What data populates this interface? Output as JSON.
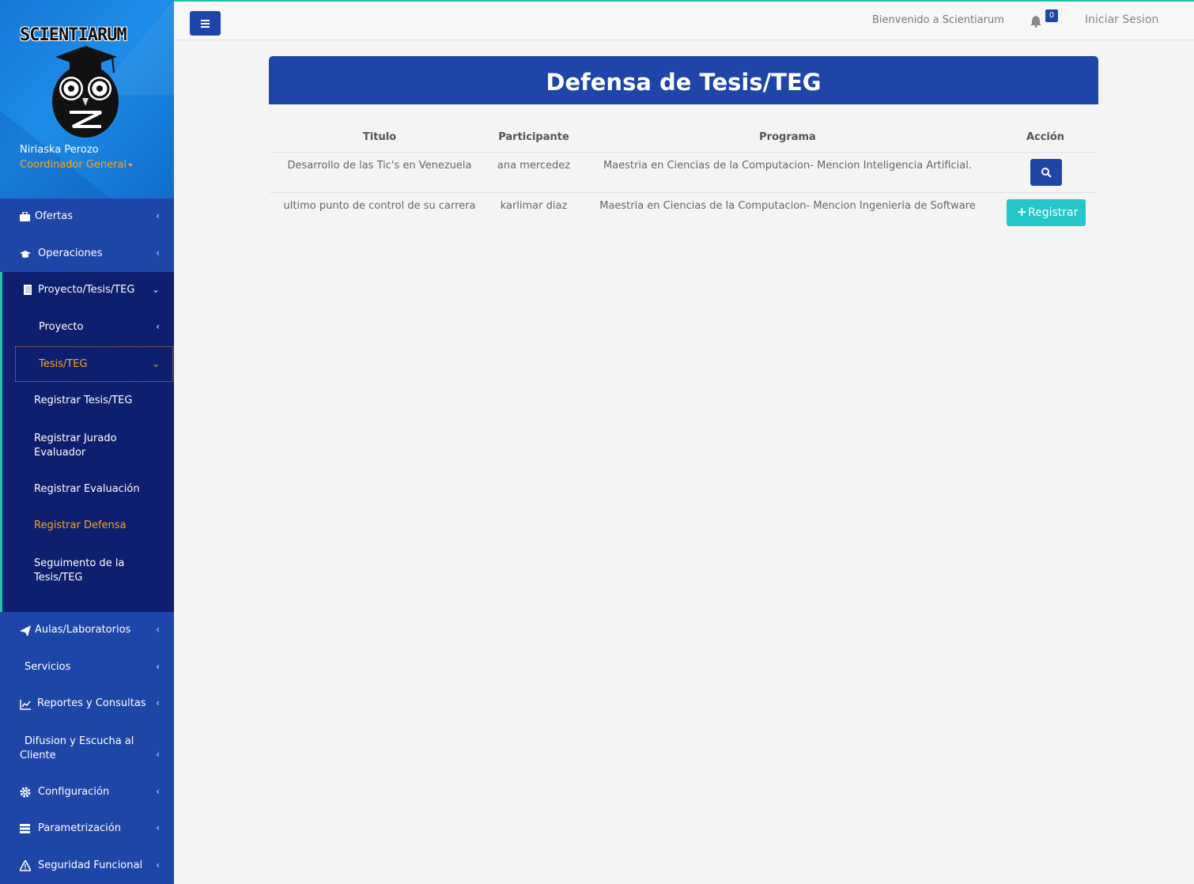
{
  "brand": {
    "logo_text": "SCIENTIARUM"
  },
  "user": {
    "name": "Niriaska Perozo",
    "role": "Coordinador General"
  },
  "sidebar": {
    "items": [
      {
        "label": "Ofertas",
        "icon": "briefcase-icon"
      },
      {
        "label": "Operaciones",
        "icon": "graduation-cap-icon"
      },
      {
        "label": "Proyecto/Tesis/TEG",
        "icon": "book-icon"
      },
      {
        "label": "Proyecto"
      },
      {
        "label": "Tesis/TEG"
      },
      {
        "label": "Registrar Tesis/TEG"
      },
      {
        "label": "Registrar Jurado Evaluador"
      },
      {
        "label": "Registrar Evaluación"
      },
      {
        "label": "Registrar Defensa"
      },
      {
        "label": "Seguimento de la Tesis/TEG"
      },
      {
        "label": "Aulas/Laboratorios",
        "icon": "paper-plane-icon"
      },
      {
        "label": "Servicios"
      },
      {
        "label": "Reportes y Consultas",
        "icon": "line-chart-icon"
      },
      {
        "label": "Difusion y Escucha al Cliente"
      },
      {
        "label": "Configuración",
        "icon": "gear-icon"
      },
      {
        "label": "Parametrización",
        "icon": "server-icon"
      },
      {
        "label": "Seguridad Funcional",
        "icon": "warning-icon"
      }
    ]
  },
  "topbar": {
    "welcome": "Bienvenido a Scientiarum",
    "notifications": "0",
    "login": "Iniciar Sesion"
  },
  "main": {
    "title": "Defensa de Tesis/TEG",
    "columns": [
      "Titulo",
      "Participante",
      "Programa",
      "Acción"
    ],
    "rows": [
      {
        "titulo": "Desarrollo de las Tic's en Venezuela",
        "participante": "ana mercedez",
        "programa": "Maestria en Ciencias de la Computacion- Mencion Inteligencia Artificial."
      },
      {
        "titulo": "ultimo punto de control de su carrera",
        "participante": "karlimar diaz",
        "programa": "Maestria en Ciencias de la Computacion- Mencion Ingenieria de Software",
        "action_label": "Registrar"
      }
    ]
  },
  "colors": {
    "primary": "#1e46a8",
    "submenu": "#0d1f6e",
    "accent_orange": "#f5a623",
    "teal": "#25c6c8",
    "top_border": "#1fc3a8"
  }
}
